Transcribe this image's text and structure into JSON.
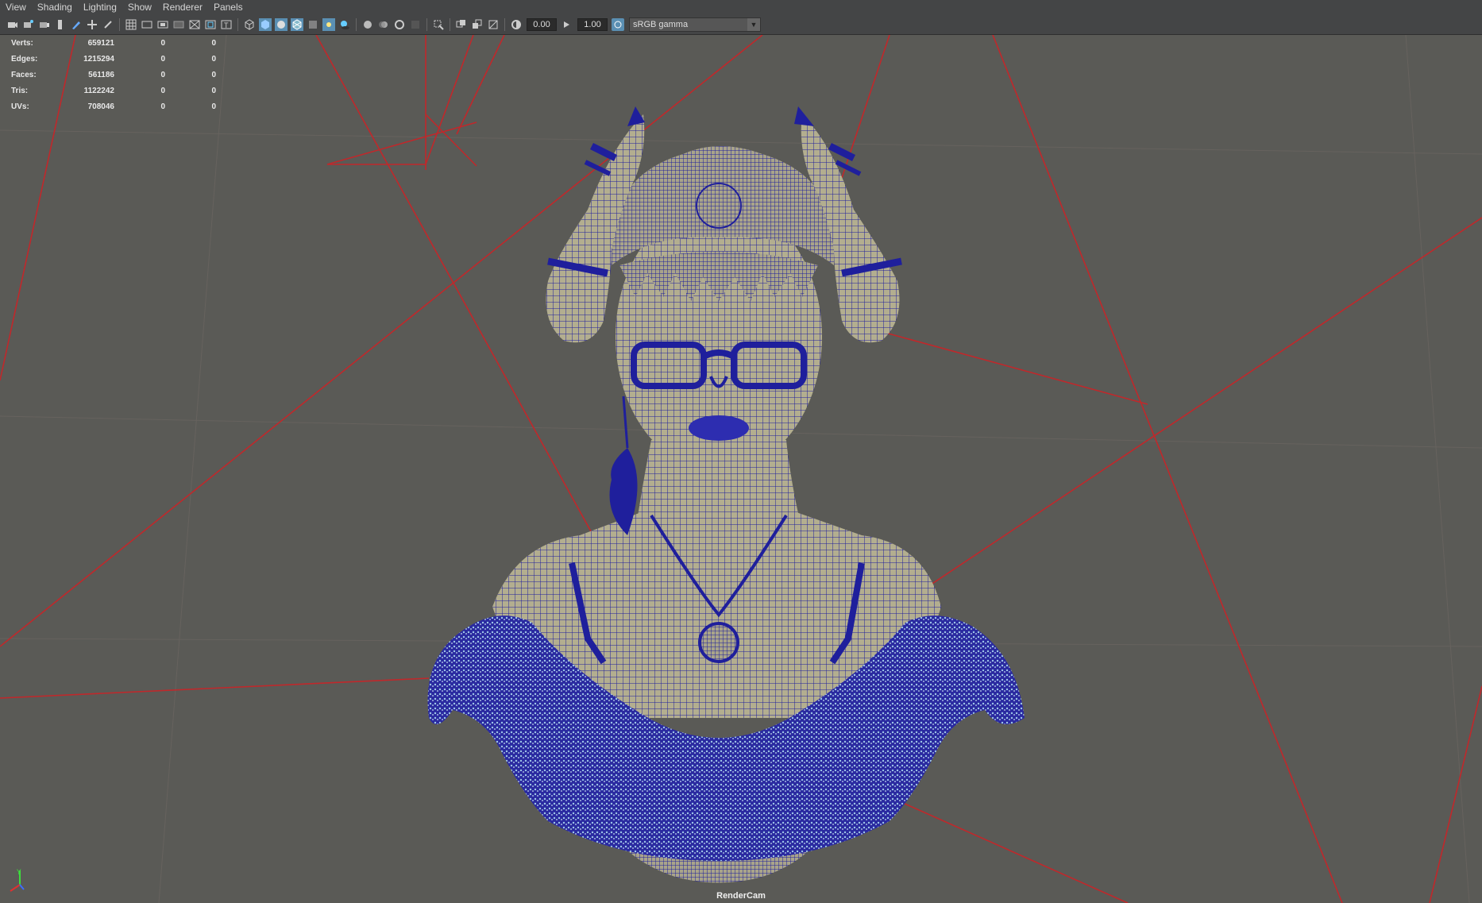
{
  "menu": [
    "View",
    "Shading",
    "Lighting",
    "Show",
    "Renderer",
    "Panels"
  ],
  "toolbar": {
    "exposure": "0.00",
    "gamma": "1.00",
    "colorspace": "sRGB gamma"
  },
  "hud": {
    "rows": [
      {
        "label": "Verts:",
        "v1": "659121",
        "v2": "0",
        "v3": "0"
      },
      {
        "label": "Edges:",
        "v1": "1215294",
        "v2": "0",
        "v3": "0"
      },
      {
        "label": "Faces:",
        "v1": "561186",
        "v2": "0",
        "v3": "0"
      },
      {
        "label": "Tris:",
        "v1": "1122242",
        "v2": "0",
        "v3": "0"
      },
      {
        "label": "UVs:",
        "v1": "708046",
        "v2": "0",
        "v3": "0"
      }
    ]
  },
  "camera_name": "RenderCam",
  "axis_label": "Y",
  "colors": {
    "background": "#5a5a56",
    "wireframe": "#1f1f9c",
    "mesh_surface": "#b3ae8f",
    "camera_lines": "#c0282b",
    "ui_panel": "#444546"
  }
}
